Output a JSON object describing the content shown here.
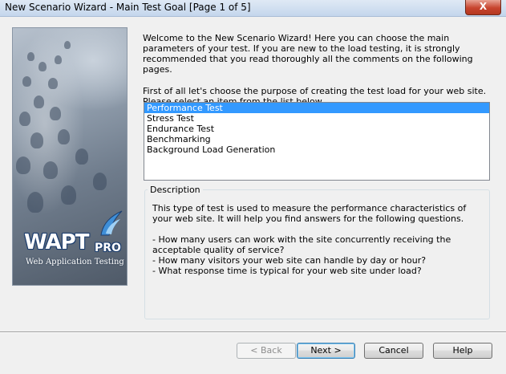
{
  "window": {
    "title": "New Scenario Wizard - Main Test Goal [Page 1 of 5]",
    "close_glyph": "X"
  },
  "logo": {
    "word": "WAPT",
    "edition": "PRO",
    "tagline": "Web Application Testing"
  },
  "intro": {
    "paragraph1": "Welcome to the New Scenario Wizard! Here you can choose the main parameters of your test. If you are new to the load testing, it is strongly recommended that you read thoroughly all the comments on the following pages.",
    "paragraph2": "First of all let's choose the purpose of creating the test load for your web site. Please select an item from the list below."
  },
  "test_types": {
    "items": [
      "Performance Test",
      "Stress Test",
      "Endurance Test",
      "Benchmarking",
      "Background Load Generation"
    ],
    "selected": "Performance Test"
  },
  "description": {
    "legend": "Description",
    "paragraph1": "This type of test is used to measure the performance characteristics of your web site. It will help you find answers for the following questions.",
    "bullet1": "- How many users can work with the site concurrently receiving the acceptable quality of service?",
    "bullet2": "- How many visitors your web site can handle by day or hour?",
    "bullet3": "- What response time is typical for your web site under load?"
  },
  "buttons": {
    "back": "< Back",
    "next": "Next >",
    "cancel": "Cancel",
    "help": "Help"
  },
  "colors": {
    "selection": "#3399ff",
    "titlebar": "#c4d6ec",
    "close_button": "#c7442e"
  }
}
